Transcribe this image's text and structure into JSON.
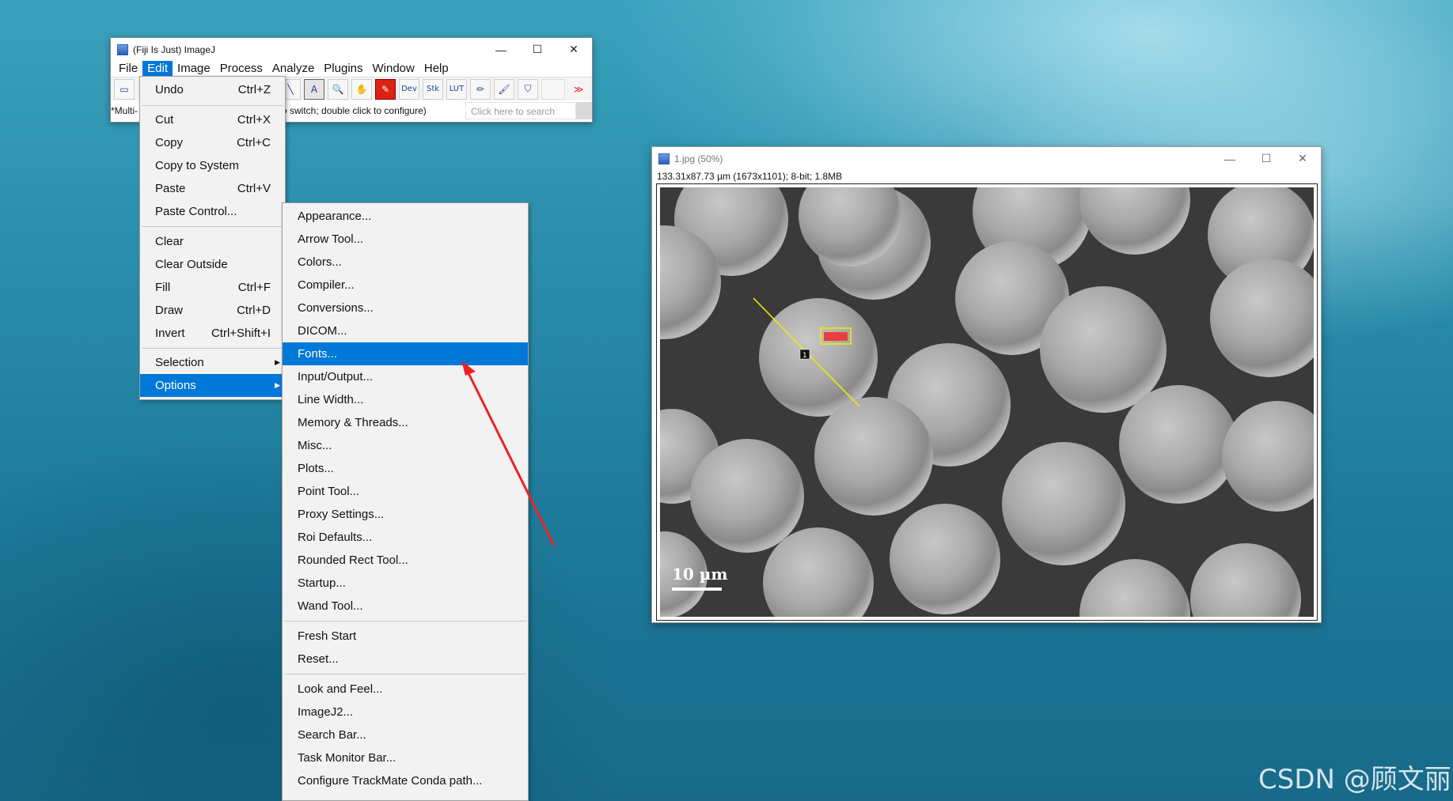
{
  "main_window": {
    "title": "(Fiji Is Just) ImageJ",
    "controls": {
      "minimize": "—",
      "maximize": "☐",
      "close": "✕"
    },
    "menus": [
      "File",
      "Edit",
      "Image",
      "Process",
      "Analyze",
      "Plugins",
      "Window",
      "Help"
    ],
    "active_menu": "Edit",
    "tools": [
      {
        "name": "rectangle-tool-icon",
        "glyph": "▭"
      },
      {
        "name": "line-tool-icon",
        "glyph": "╲"
      },
      {
        "name": "text-tool-icon",
        "glyph": "A"
      },
      {
        "name": "magnifier-tool-icon",
        "glyph": "🔍"
      },
      {
        "name": "hand-tool-icon",
        "glyph": "✋"
      },
      {
        "name": "color-picker-tool-icon",
        "glyph": "✎"
      },
      {
        "name": "dev-tool-icon",
        "glyph": "Dev"
      },
      {
        "name": "stk-tool-icon",
        "glyph": "Stk"
      },
      {
        "name": "lut-tool-icon",
        "glyph": "LUT"
      },
      {
        "name": "pencil-tool-icon",
        "glyph": "✏"
      },
      {
        "name": "brush-tool-icon",
        "glyph": "🖌"
      },
      {
        "name": "flood-fill-tool-icon",
        "glyph": "⛉"
      },
      {
        "name": "more-tools-icon",
        "glyph": "≫"
      }
    ],
    "status_left": "*Multi-",
    "status_right": "o switch; double click to configure)",
    "search_placeholder": "Click here to search"
  },
  "edit_menu": {
    "items": [
      {
        "label": "Undo",
        "shortcut": "Ctrl+Z"
      },
      {
        "label": "Cut",
        "shortcut": "Ctrl+X"
      },
      {
        "label": "Copy",
        "shortcut": "Ctrl+C"
      },
      {
        "label": "Copy to System",
        "shortcut": ""
      },
      {
        "label": "Paste",
        "shortcut": "Ctrl+V"
      },
      {
        "label": "Paste Control...",
        "shortcut": ""
      },
      {
        "label": "Clear",
        "shortcut": ""
      },
      {
        "label": "Clear Outside",
        "shortcut": ""
      },
      {
        "label": "Fill",
        "shortcut": "Ctrl+F"
      },
      {
        "label": "Draw",
        "shortcut": "Ctrl+D"
      },
      {
        "label": "Invert",
        "shortcut": "Ctrl+Shift+I"
      },
      {
        "label": "Selection",
        "shortcut": ""
      },
      {
        "label": "Options",
        "shortcut": ""
      }
    ],
    "highlighted": "Options"
  },
  "options_menu": {
    "items": [
      "Appearance...",
      "Arrow Tool...",
      "Colors...",
      "Compiler...",
      "Conversions...",
      "DICOM...",
      "Fonts...",
      "Input/Output...",
      "Line Width...",
      "Memory & Threads...",
      "Misc...",
      "Plots...",
      "Point Tool...",
      "Proxy Settings...",
      "Roi Defaults...",
      "Rounded Rect Tool...",
      "Startup...",
      "Wand Tool...",
      "Fresh Start",
      "Reset...",
      "Look and Feel...",
      "ImageJ2...",
      "Search Bar...",
      "Task Monitor Bar...",
      "Configure TrackMate Conda path..."
    ],
    "highlighted": "Fonts..."
  },
  "image_window": {
    "title": "1.jpg (50%)",
    "info": "133.31x87.73 µm (1673x1101); 8-bit; 1.8MB",
    "scale_bar_label": "10 µm",
    "roi_label": "1"
  },
  "annotation": {
    "arrow_color": "#ee2222"
  },
  "colors": {
    "accent": "#0078d7",
    "roi_line": "#f0f000"
  },
  "watermark": "CSDN @顾文丽"
}
